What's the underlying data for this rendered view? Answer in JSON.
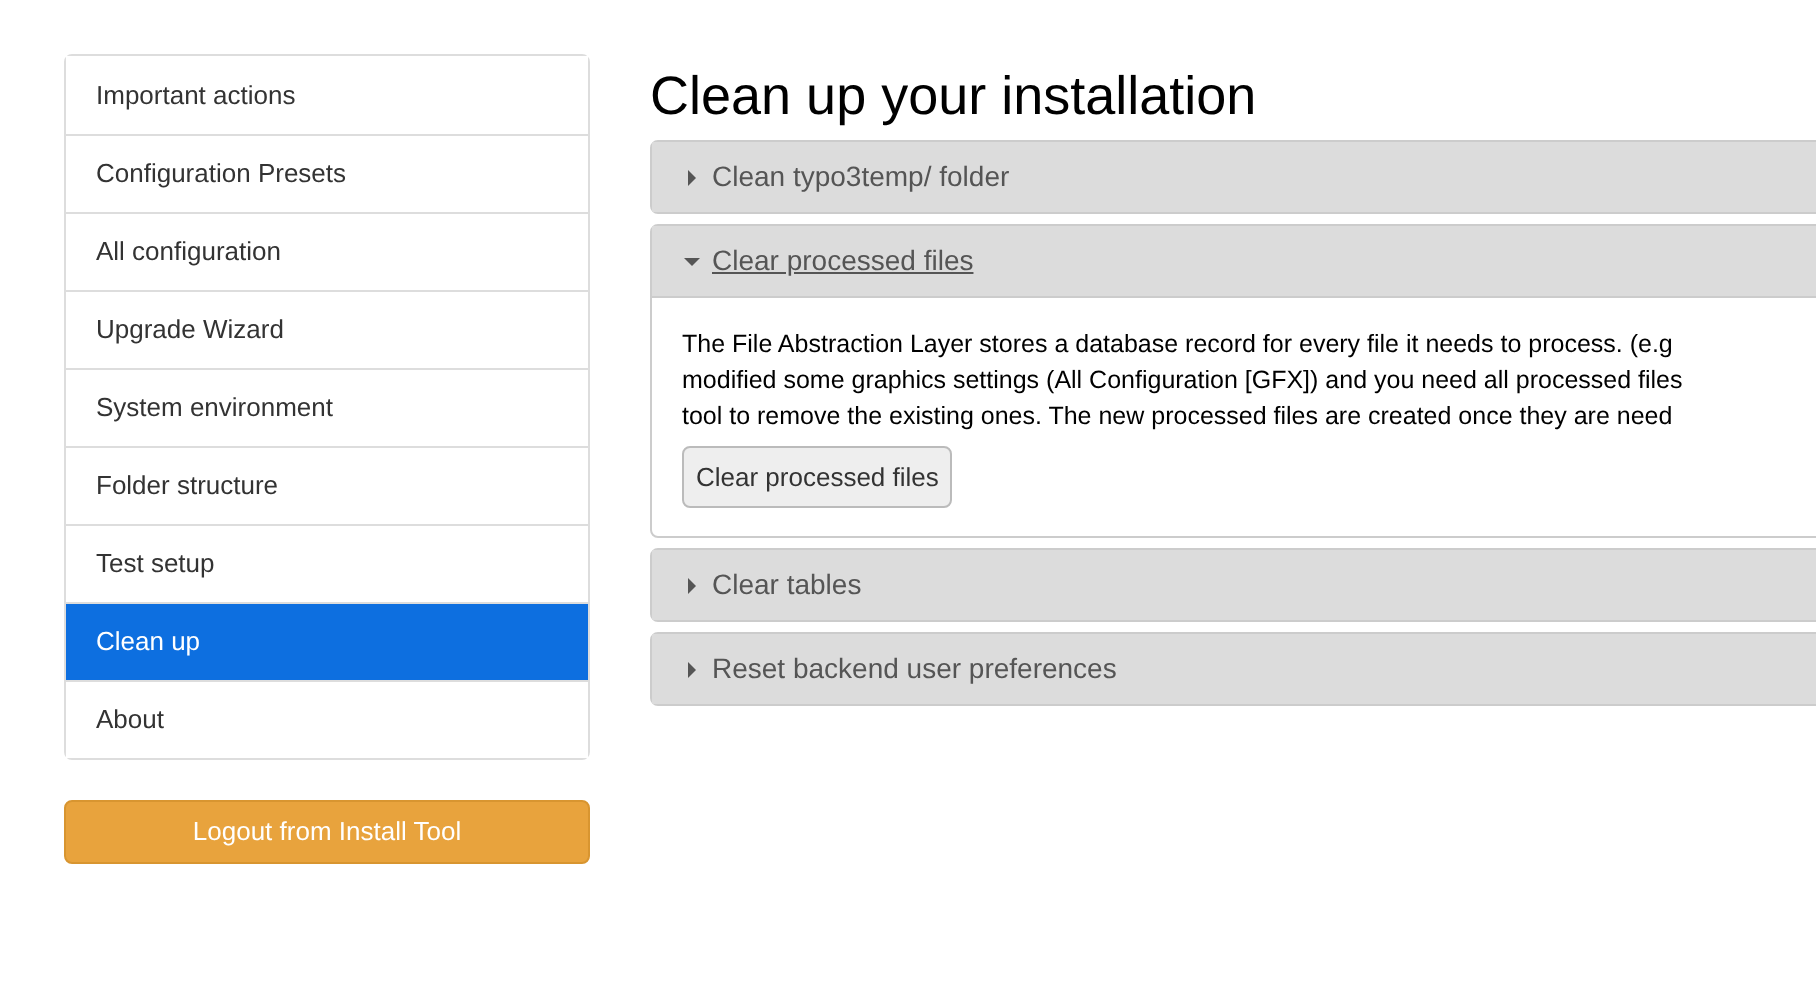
{
  "sidebar": {
    "items": [
      {
        "label": "Important actions",
        "selected": false
      },
      {
        "label": "Configuration Presets",
        "selected": false
      },
      {
        "label": "All configuration",
        "selected": false
      },
      {
        "label": "Upgrade Wizard",
        "selected": false
      },
      {
        "label": "System environment",
        "selected": false
      },
      {
        "label": "Folder structure",
        "selected": false
      },
      {
        "label": "Test setup",
        "selected": false
      },
      {
        "label": "Clean up",
        "selected": true
      },
      {
        "label": "About",
        "selected": false
      }
    ],
    "logout_button": "Logout from Install Tool"
  },
  "page_title": "Clean up your installation",
  "panels": [
    {
      "title": "Clean typo3temp/ folder",
      "expanded": false
    },
    {
      "title": "Clear processed files",
      "expanded": true,
      "body_lines": [
        "The File Abstraction Layer stores a database record for every file it needs to process. (e.g",
        "modified some graphics settings (All Configuration [GFX]) and you need all processed files",
        "tool to remove the existing ones. The new processed files are created once they are need"
      ],
      "button": "Clear processed files"
    },
    {
      "title": "Clear tables",
      "expanded": false
    },
    {
      "title": "Reset backend user preferences",
      "expanded": false
    }
  ]
}
